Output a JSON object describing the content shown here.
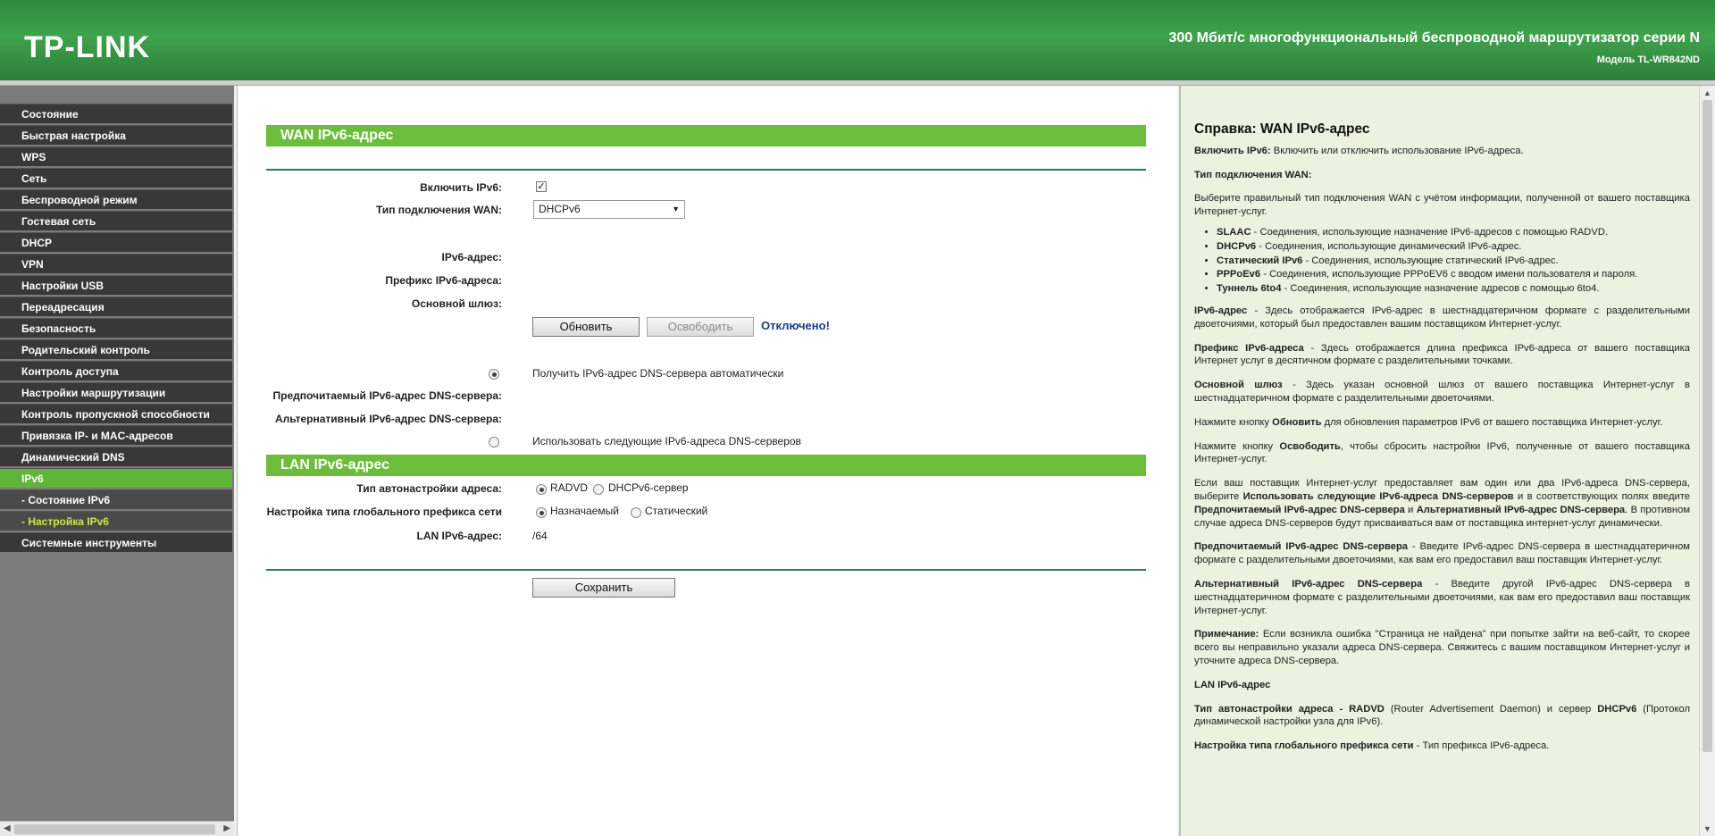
{
  "header": {
    "logo": "TP-LINK",
    "title": "300 Мбит/с многофункциональный беспроводной маршрутизатор серии N",
    "model": "Модель TL-WR842ND"
  },
  "sidebar": {
    "items": [
      {
        "label": "Состояние"
      },
      {
        "label": "Быстрая настройка"
      },
      {
        "label": "WPS"
      },
      {
        "label": "Сеть"
      },
      {
        "label": "Беспроводной режим"
      },
      {
        "label": "Гостевая сеть"
      },
      {
        "label": "DHCP"
      },
      {
        "label": "VPN"
      },
      {
        "label": "Настройки USB"
      },
      {
        "label": "Переадресация"
      },
      {
        "label": "Безопасность"
      },
      {
        "label": "Родительский контроль"
      },
      {
        "label": "Контроль доступа"
      },
      {
        "label": "Настройки маршрутизации"
      },
      {
        "label": "Контроль пропускной способности"
      },
      {
        "label": "Привязка IP- и MAC-адресов"
      },
      {
        "label": "Динамический DNS"
      },
      {
        "label": "IPv6"
      },
      {
        "label": "- Состояние IPv6"
      },
      {
        "label": "- Настройка IPv6"
      },
      {
        "label": "Системные инструменты"
      }
    ]
  },
  "wan": {
    "title": "WAN IPv6-адрес",
    "enable_label": "Включить IPv6:",
    "enable_checked": true,
    "conn_type_label": "Тип подключения WAN:",
    "conn_type_value": "DHCPv6",
    "ipv6_addr_label": "IPv6-адрес:",
    "prefix_label": "Префикс IPv6-адреса:",
    "gateway_label": "Основной шлюз:",
    "refresh_btn": "Обновить",
    "release_btn": "Освободить",
    "status": "Отключено!",
    "dns_auto": "Получить IPv6-адрес DNS-сервера автоматически",
    "dns_preferred_label": "Предпочитаемый IPv6-адрес DNS-сервера:",
    "dns_alt_label": "Альтернативный IPv6-адрес DNS-сервера:",
    "dns_manual": "Использовать следующие IPv6-адреса DNS-серверов"
  },
  "lan": {
    "title": "LAN IPv6-адрес",
    "autoconf_label": "Тип автонастройки адреса:",
    "autoconf_opt1": "RADVD",
    "autoconf_opt2": "DHCPv6-сервер",
    "prefix_type_label": "Настройка типа глобального префикса сети",
    "prefix_opt1": "Назначаемый",
    "prefix_opt2": "Статический",
    "lan_addr_label": "LAN IPv6-адрес:",
    "lan_addr_value": "/64",
    "save_btn": "Сохранить"
  },
  "help": {
    "title": "Справка: WAN IPv6-адрес",
    "p_enable_b": "Включить IPv6:",
    "p_enable": " Включить или отключить использование IPv6-адреса.",
    "conn_type_h": "Тип подключения WAN:",
    "conn_type_p": "Выберите правильный тип подключения WAN с учётом информации, полученной от вашего поставщика Интернет-услуг.",
    "list": [
      {
        "b": "SLAAC",
        "t": " - Соединения, использующие назначение IPv6-адресов с помощью RADVD."
      },
      {
        "b": "DHCPv6",
        "t": " - Соединения, использующие динамический IPv6-адрес."
      },
      {
        "b": "Статический IPv6",
        "t": " - Соединения, использующие статический IPv6-адрес."
      },
      {
        "b": "PPPoEv6",
        "t": " - Соединения, использующие PPPoEV6 с вводом имени пользователя и пароля."
      },
      {
        "b": "Туннель 6to4",
        "t": " - Соединения, использующие назначение адресов с помощью 6to4."
      }
    ],
    "p_addr_b": "IPv6-адрес",
    "p_addr": " - Здесь отображается IPv6-адрес в шестнадцатеричном формате с разделительными двоеточиями, который был предоставлен вашим поставщиком Интернет-услуг.",
    "p_prefix_b": "Префикс IPv6-адреса",
    "p_prefix": " - Здесь отображается длина префикса IPv6-адреса от вашего поставщика Интернет услуг в десятичном формате с разделительными точками.",
    "p_gw_b": "Основной шлюз",
    "p_gw": " - Здесь указан основной шлюз от вашего поставщика Интернет-услуг в шестнадцатеричном формате с разделительными двоеточиями.",
    "p_refresh_1": "Нажмите кнопку ",
    "p_refresh_b": "Обновить",
    "p_refresh_2": " для обновления параметров IPv6 от вашего поставщика Интернет-услуг.",
    "p_release_1": "Нажмите кнопку ",
    "p_release_b": "Освободить",
    "p_release_2": ", чтобы сбросить настройки IPv6, полученные от вашего поставщика Интернет-услуг.",
    "p_dns_1": "Если ваш поставщик Интернет-услуг предоставляет вам один или два IPv6-адреса DNS-сервера, выберите ",
    "p_dns_b1": "Использовать следующие IPv6-адреса DNS-серверов",
    "p_dns_2": " и в соответствующих полях введите ",
    "p_dns_b2": "Предпочитаемый IPv6-адрес DNS-сервера",
    "p_dns_3": " и ",
    "p_dns_b3": "Альтернативный IPv6-адрес DNS-сервера",
    "p_dns_4": ". В противном случае адреса DNS-серверов будут присваиваться вам от поставщика интернет-услуг динамически.",
    "p_pref_b": "Предпочитаемый IPv6-адрес DNS-сервера",
    "p_pref": " - Введите IPv6-адрес DNS-сервера в шестнадцатеричном формате с разделительными двоеточиями, как вам его предоставил ваш поставщик Интернет-услуг.",
    "p_alt_b": "Альтернативный IPv6-адрес DNS-сервера",
    "p_alt": " - Введите другой IPv6-адрес DNS-сервера в шестнадцатеричном формате с разделительными двоеточиями, как вам его предоставил ваш поставщик Интернет-услуг.",
    "p_note_b": "Примечание:",
    "p_note": " Если возникла ошибка \"Страница не найдена\" при попытке зайти на веб-сайт, то скорее всего вы неправильно указали адреса DNS-сервера. Свяжитесь с вашим поставщиком Интернет-услуг и уточните адреса DNS-сервера.",
    "lan_h": "LAN IPv6-адрес",
    "p_auto_b": "Тип автонастройки адреса - RADVD",
    "p_auto_1": " (Router Advertisement Daemon) и сервер ",
    "p_auto_b2": "DHCPv6",
    "p_auto_2": " (Протокол динамической настройки узла для IPv6).",
    "p_gprefix_b": "Настройка типа глобального префикса сети",
    "p_gprefix": " - Тип префикса IPv6-адреса."
  }
}
